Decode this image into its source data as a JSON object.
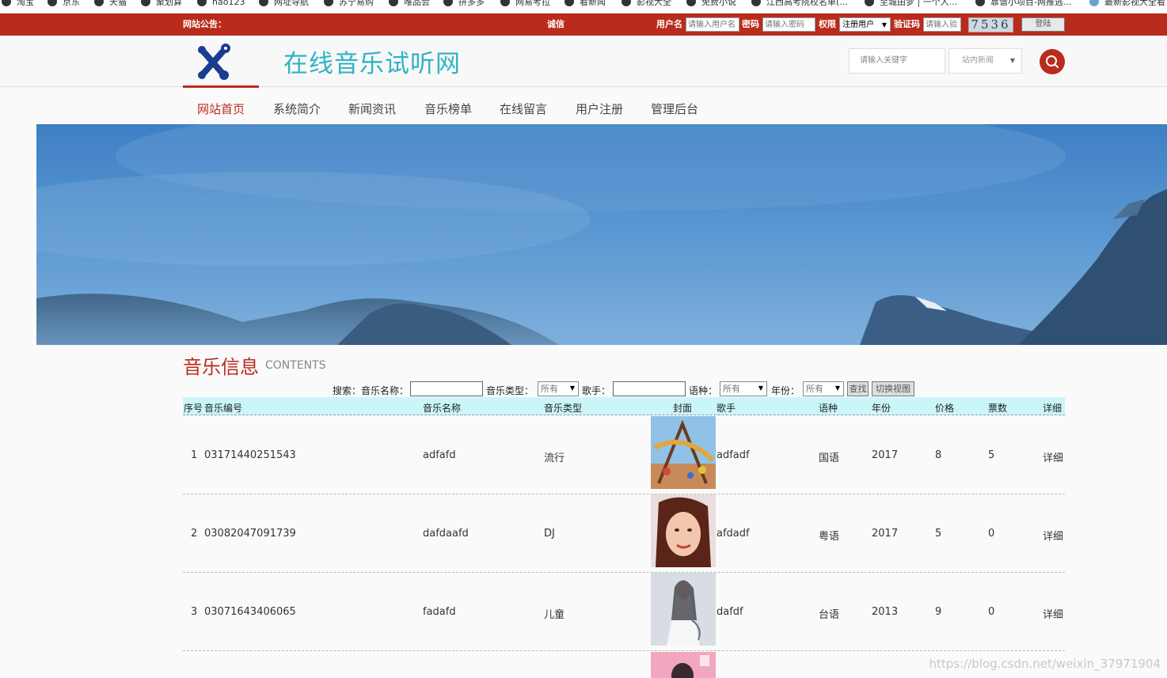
{
  "bookmarks": [
    "淘宝",
    "京东",
    "天猫",
    "聚划算",
    "hao123",
    "网址导航",
    "苏宁易购",
    "唯品会",
    "拼多多",
    "网易考拉",
    "看新闻",
    "影视大全",
    "免费小说",
    "江西高考院校名单(...",
    "至城由梦 | 一个人...",
    "靠谱小项目-网推逃...",
    "最新影视大全看"
  ],
  "topbar": {
    "notice_label": "网站公告：",
    "notice_text": "诚信",
    "username_label": "用户名",
    "username_placeholder": "请输入用户名",
    "password_label": "密码",
    "password_placeholder": "请输入密码",
    "role_label": "权限",
    "role_value": "注册用户",
    "captcha_label": "验证码",
    "captcha_placeholder": "请输入验",
    "captcha_code": "7536",
    "login_label": "登陆"
  },
  "header": {
    "site_title": "在线音乐试听网",
    "search_placeholder": "请输入关键字",
    "search_scope": "站内新闻"
  },
  "nav": {
    "items": [
      "网站首页",
      "系统简介",
      "新闻资讯",
      "音乐榜单",
      "在线留言",
      "用户注册",
      "管理后台"
    ],
    "active": "网站首页"
  },
  "banner": {
    "slides": 5,
    "active_slide": 1
  },
  "section": {
    "title": "音乐信息",
    "subtitle": "CONTENTS"
  },
  "filter": {
    "search_label": "搜索：音乐名称：",
    "type_label": "音乐类型：",
    "type_value": "所有",
    "singer_label": "歌手：",
    "lang_label": "语种：",
    "lang_value": "所有",
    "year_label": "年份：",
    "year_value": "所有",
    "find_label": "查找",
    "switch_label": "切换视图"
  },
  "table": {
    "headers": [
      "序号",
      "音乐编号",
      "音乐名称",
      "音乐类型",
      "封面",
      "歌手",
      "语种",
      "年份",
      "价格",
      "票数",
      "详细"
    ],
    "rows": [
      {
        "no": "1",
        "code": "03171440251543",
        "name": "adfafd",
        "type": "流行",
        "singer": "adfadf",
        "lang": "国语",
        "year": "2017",
        "price": "8",
        "votes": "5",
        "detail": "详细"
      },
      {
        "no": "2",
        "code": "03082047091739",
        "name": "dafdaafd",
        "type": "DJ",
        "singer": "afdadf",
        "lang": "粤语",
        "year": "2017",
        "price": "5",
        "votes": "0",
        "detail": "详细"
      },
      {
        "no": "3",
        "code": "03071643406065",
        "name": "fadafd",
        "type": "儿童",
        "singer": "dafdf",
        "lang": "台语",
        "year": "2013",
        "price": "9",
        "votes": "0",
        "detail": "详细"
      }
    ]
  },
  "watermark": "https://blog.csdn.net/weixin_37971904",
  "colors": {
    "brand_red": "#b92c1d",
    "title_cyan": "#2fb3c4",
    "table_head": "#caf6fa"
  }
}
